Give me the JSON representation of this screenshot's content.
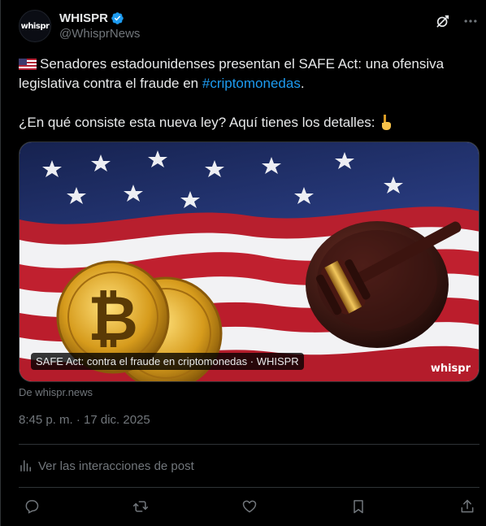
{
  "author": {
    "display_name": "WHISPR",
    "handle": "@WhisprNews",
    "avatar_text": "whispr",
    "verified": true
  },
  "post": {
    "line1_before_hashtag": "Senadores estadounidenses presentan el SAFE Act: una ofensiva legislativa contra el fraude en ",
    "hashtag": "#criptomonedas",
    "line1_after_hashtag": ".",
    "line2": "¿En qué consiste esta nueva ley? Aquí tienes los detalles:",
    "flag_emoji": "us-flag",
    "point_emoji": "point-down"
  },
  "media": {
    "caption": "SAFE Act: contra el fraude en criptomonedas · WHISPR",
    "watermark": "whispr",
    "source": "De whispr.news"
  },
  "meta": {
    "timestamp": "8:45 p. m. · 17 dic. 2025",
    "analytics_label": "Ver las interacciones de post"
  },
  "actions": [
    "reply-icon",
    "repost-icon",
    "like-icon",
    "bookmark-icon",
    "share-icon"
  ],
  "colors": {
    "background": "#000000",
    "text": "#e7e9ea",
    "secondary": "#71767b",
    "link": "#1d9bf0",
    "border": "#2f3336"
  }
}
